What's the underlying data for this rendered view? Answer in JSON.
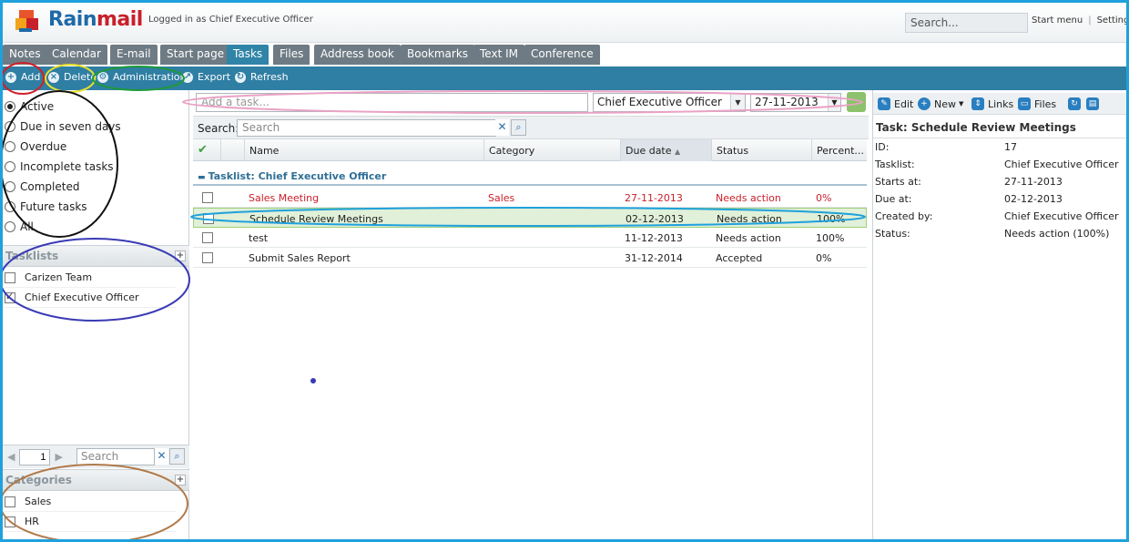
{
  "header": {
    "logo_rain": "Rain",
    "logo_mail": "mail",
    "logged_in": "Logged in as Chief Executive Officer",
    "search_placeholder": "Search...",
    "start_menu": "Start menu",
    "separator": "|",
    "settings": "Setting"
  },
  "tabs": [
    "Notes",
    "Calendar",
    "E-mail",
    "Start page",
    "Tasks",
    "Files",
    "Address book",
    "Bookmarks",
    "Text IM",
    "Conference"
  ],
  "active_tab": "Tasks",
  "toolbar": {
    "add": "Add",
    "delete": "Delete",
    "administration": "Administration",
    "export": "Export",
    "refresh": "Refresh"
  },
  "filters": {
    "options": [
      "Active",
      "Due in seven days",
      "Overdue",
      "Incomplete tasks",
      "Completed",
      "Future tasks",
      "All"
    ],
    "selected": "Active"
  },
  "tasklists": {
    "title": "Tasklists",
    "items": [
      {
        "label": "Carizen Team",
        "checked": false
      },
      {
        "label": "Chief Executive Officer",
        "checked": true
      }
    ]
  },
  "pager": {
    "page": "1",
    "search_placeholder": "Search"
  },
  "categories": {
    "title": "Categories",
    "items": [
      {
        "label": "Sales",
        "checked": false
      },
      {
        "label": "HR",
        "checked": false
      }
    ]
  },
  "task_entry": {
    "placeholder": "Add a task...",
    "owner": "Chief Executive Officer",
    "date": "27-11-2013"
  },
  "grid": {
    "search_label": "Search:",
    "search_placeholder": "Search",
    "columns": {
      "name": "Name",
      "category": "Category",
      "due_date": "Due date",
      "status": "Status",
      "percent": "Percent..."
    },
    "group_label": "Tasklist: Chief Executive Officer",
    "rows": [
      {
        "name": "Sales Meeting",
        "category": "Sales",
        "due": "27-11-2013",
        "status": "Needs action",
        "percent": "0%",
        "overdue": true
      },
      {
        "name": "Schedule Review Meetings",
        "category": "",
        "due": "02-12-2013",
        "status": "Needs action",
        "percent": "100%",
        "selected": true
      },
      {
        "name": "test",
        "category": "",
        "due": "11-12-2013",
        "status": "Needs action",
        "percent": "100%"
      },
      {
        "name": "Submit Sales Report",
        "category": "",
        "due": "31-12-2014",
        "status": "Accepted",
        "percent": "0%"
      }
    ]
  },
  "detail": {
    "toolbar": {
      "edit": "Edit",
      "new": "New",
      "links": "Links",
      "files": "Files"
    },
    "title": "Task: Schedule Review Meetings",
    "fields": [
      {
        "label": "ID:",
        "value": "17"
      },
      {
        "label": "Tasklist:",
        "value": "Chief Executive Officer"
      },
      {
        "label": "Starts at:",
        "value": "27-11-2013"
      },
      {
        "label": "Due at:",
        "value": "02-12-2013"
      },
      {
        "label": "Created by:",
        "value": "Chief Executive Officer"
      },
      {
        "label": "Status:",
        "value": "Needs action (100%)"
      }
    ]
  },
  "colors": {
    "accent": "#2f7ea3",
    "tab_bg": "#6e7b84",
    "overdue": "#c8202a",
    "frame": "#1ea1dc"
  }
}
